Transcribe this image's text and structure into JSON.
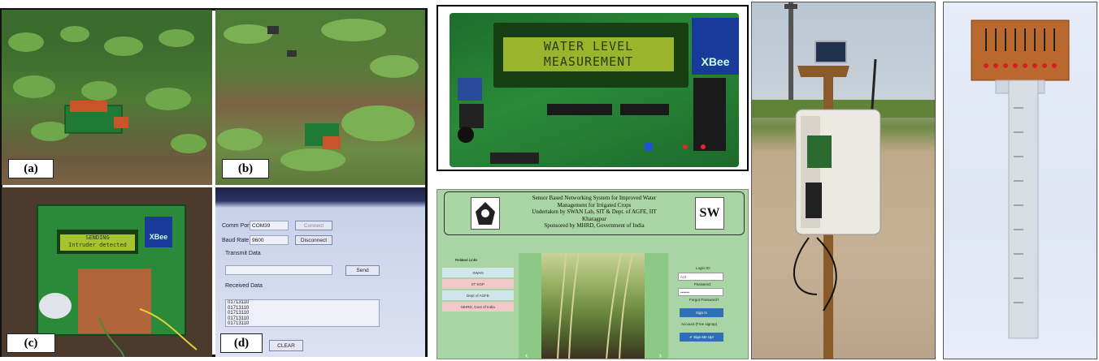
{
  "panels": {
    "a": {
      "label": "(a)"
    },
    "b": {
      "label": "(b)"
    },
    "c": {
      "label": "(c)",
      "lcd_line1": "SENDING",
      "lcd_line2": "Intruder detected"
    },
    "d": {
      "label": "(d)",
      "comm_port_label": "Comm Port",
      "comm_port_value": "COM39",
      "connect_label": "Connect",
      "baud_rate_label": "Baud Rate",
      "baud_rate_value": "9600",
      "disconnect_label": "Disconnect",
      "transmit_label": "Transmit Data",
      "send_label": "Send",
      "received_label": "Received Data",
      "received_rows": [
        "01713110",
        "01713110",
        "01713110",
        "01713110",
        "01713110"
      ],
      "clear_label": "CLEAR"
    }
  },
  "lcd_board": {
    "line1": "WATER LEVEL",
    "line2": "MEASUREMENT",
    "module_label": "XBee"
  },
  "website": {
    "title_lines": [
      "Sensor Based Networking System for Improved Water",
      "Management for Irrigated Crops",
      "Undertaken by SWAN Lab, SIT & Dept. of AGFE, IIT",
      "Kharagpur",
      "Sponsored by MHRD, Government of India"
    ],
    "right_logo": "SW",
    "links_heading": "Related Links",
    "links": [
      "SWAN",
      "IIT KGP",
      "Dept of AGFE",
      "MHRD, Govt of India"
    ],
    "link_colors": [
      "#cfe6ea",
      "#f1c9c9",
      "#cfe6ea",
      "#f1c9c9"
    ],
    "login_heading": "Login ID:",
    "login_value": "AAI",
    "password_label": "Password:",
    "password_value": "•••••••",
    "forgot_label": "Forgot Password?",
    "signin_label": "Sign In",
    "account_prompt": "Account (Free signup)",
    "signup_label": "✔ Sign Me Up!"
  },
  "colors": {
    "pcb": "#2a8a39",
    "lcd_bg": "#9ab52b",
    "web_bg": "#a9d4a3",
    "signin": "#2f6fb8"
  }
}
